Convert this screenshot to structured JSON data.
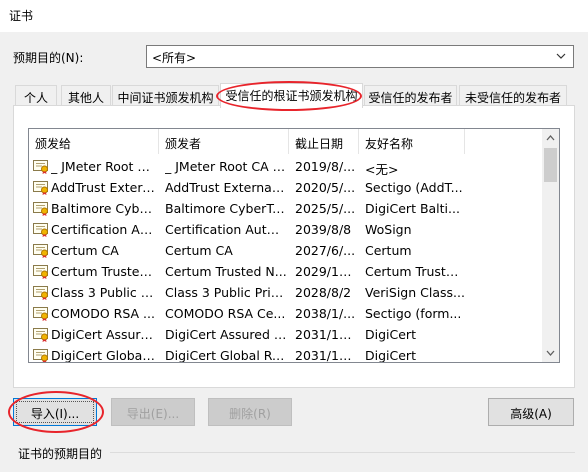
{
  "window": {
    "title": "证书"
  },
  "purpose": {
    "label": "预期目的(N):",
    "selected": "<所有>"
  },
  "tabs": [
    {
      "label": "个人"
    },
    {
      "label": "其他人"
    },
    {
      "label": "中间证书颁发机构"
    },
    {
      "label": "受信任的根证书颁发机构",
      "active": true
    },
    {
      "label": "受信任的发布者"
    },
    {
      "label": "未受信任的发布者"
    }
  ],
  "columns": {
    "issued_to": "颁发给",
    "issued_by": "颁发者",
    "expiry": "截止日期",
    "friendly": "友好名称"
  },
  "rows": [
    {
      "issued_to": "_ JMeter Root C...",
      "issued_by": "_ JMeter Root CA f...",
      "expiry": "2019/8/...",
      "friendly": "<无>"
    },
    {
      "issued_to": "AddTrust Extern...",
      "issued_by": "AddTrust External ...",
      "expiry": "2020/5/...",
      "friendly": "Sectigo (AddT..."
    },
    {
      "issued_to": "Baltimore Cyber...",
      "issued_by": "Baltimore CyberTr...",
      "expiry": "2025/5/...",
      "friendly": "DigiCert Balti..."
    },
    {
      "issued_to": "Certification Aut...",
      "issued_by": "Certification Autho...",
      "expiry": "2039/8/8",
      "friendly": "WoSign"
    },
    {
      "issued_to": "Certum CA",
      "issued_by": "Certum CA",
      "expiry": "2027/6/...",
      "friendly": "Certum"
    },
    {
      "issued_to": "Certum Trusted ...",
      "issued_by": "Certum Trusted N...",
      "expiry": "2029/12...",
      "friendly": "Certum Truste..."
    },
    {
      "issued_to": "Class 3 Public Pr...",
      "issued_by": "Class 3 Public Prim...",
      "expiry": "2028/8/2",
      "friendly": "VeriSign Class..."
    },
    {
      "issued_to": "COMODO RSA ...",
      "issued_by": "COMODO RSA Ce...",
      "expiry": "2038/1/...",
      "friendly": "Sectigo (form..."
    },
    {
      "issued_to": "DigiCert Assure...",
      "issued_by": "DigiCert Assured I...",
      "expiry": "2031/11...",
      "friendly": "DigiCert"
    },
    {
      "issued_to": "DigiCert Global ...",
      "issued_by": "DigiCert Global Ro...",
      "expiry": "2031/11...",
      "friendly": "DigiCert"
    }
  ],
  "buttons": {
    "import": "导入(I)...",
    "export": "导出(E)...",
    "remove": "删除(R)",
    "advanced": "高级(A)"
  },
  "group": {
    "label": "证书的预期目的"
  },
  "colors": {
    "annotation": "#e8242b",
    "focus": "#0078d7"
  }
}
